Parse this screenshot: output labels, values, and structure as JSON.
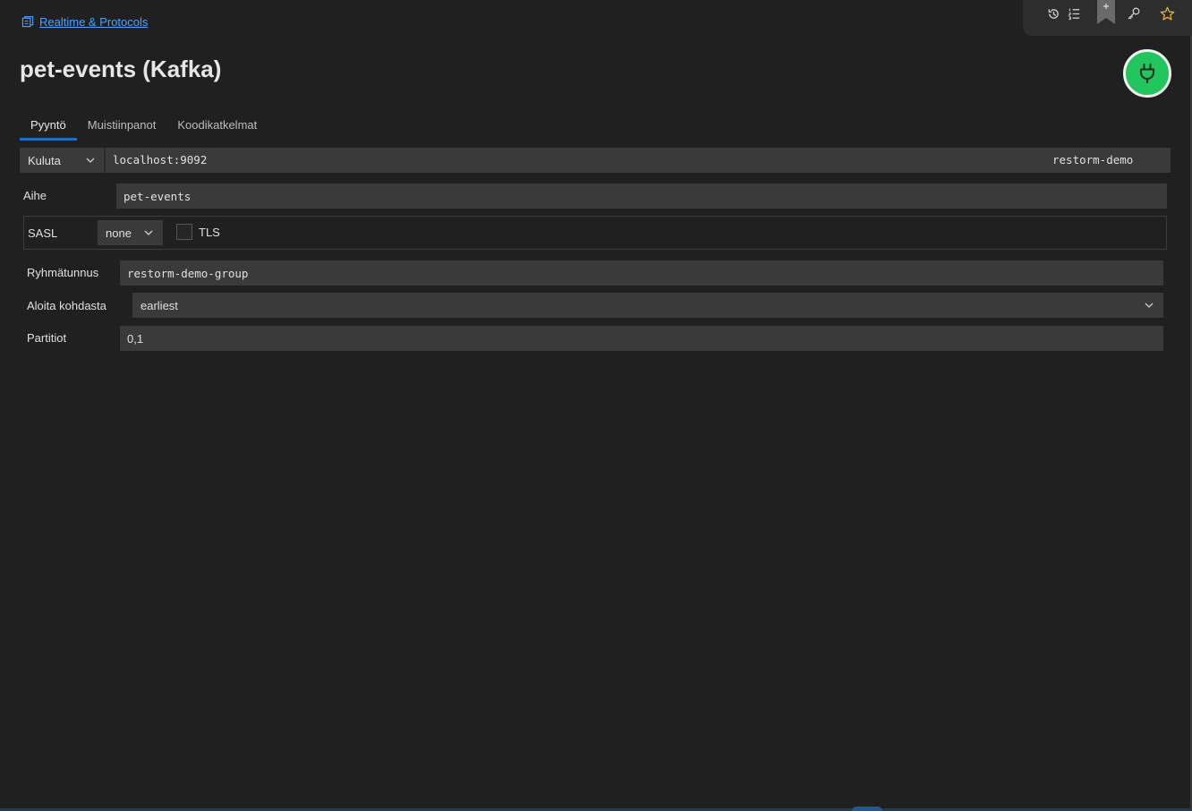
{
  "breadcrumb": {
    "label": "Realtime & Protocols"
  },
  "page": {
    "title": "pet-events (Kafka)"
  },
  "tabs": [
    {
      "label": "Pyyntö",
      "active": true
    },
    {
      "label": "Muistiinpanot",
      "active": false
    },
    {
      "label": "Koodikatkelmat",
      "active": false
    }
  ],
  "request": {
    "method": "Kuluta",
    "url": "localhost:9092",
    "environment": "restorm-demo"
  },
  "topic": {
    "label": "Aihe",
    "value": "pet-events"
  },
  "sasl": {
    "label": "SASL",
    "value": "none",
    "tls_label": "TLS",
    "tls_checked": false
  },
  "group": {
    "label": "Ryhmätunnus",
    "value": "restorm-demo-group"
  },
  "start": {
    "label": "Aloita kohdasta",
    "value": "earliest"
  },
  "partitions": {
    "label": "Partitiot",
    "value": "0,1"
  },
  "colors": {
    "accent": "#4ea1ff",
    "connect": "#22c55e",
    "background": "#202020"
  }
}
